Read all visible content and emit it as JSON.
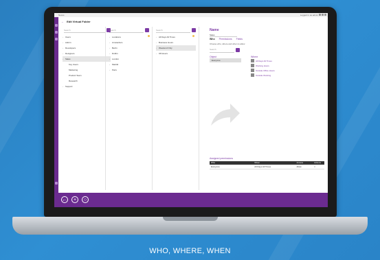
{
  "caption": "WHO, WHERE, WHEN",
  "app": {
    "title": "Edit Virtual Folder",
    "titlebar_left": "Nexus",
    "titlebar_right": "Logged in as admin",
    "search_placeholder": "Search",
    "columns": {
      "col1": [
        {
          "label": "Users",
          "sub": false
        },
        {
          "label": "Admin",
          "sub": false
        },
        {
          "label": "Developers",
          "sub": false
        },
        {
          "label": "Designers",
          "sub": false
        },
        {
          "label": "Sales",
          "sub": false,
          "selected": true
        },
        {
          "label": "Key Users",
          "sub": true
        },
        {
          "label": "Marketing",
          "sub": true
        },
        {
          "label": "Product Team",
          "sub": true
        },
        {
          "label": "Research",
          "sub": true
        },
        {
          "label": "Support",
          "sub": false
        }
      ],
      "col2": [
        {
          "label": "Locations"
        },
        {
          "label": "Amsterdam"
        },
        {
          "label": "Berlin"
        },
        {
          "label": "Dublin"
        },
        {
          "label": "London"
        },
        {
          "label": "Madrid"
        },
        {
          "label": "Paris"
        }
      ],
      "col3": [
        {
          "label": "All Days All Times"
        },
        {
          "label": "Business Hours"
        },
        {
          "label": "Weekend Only",
          "selected": true
        },
        {
          "label": "Off-Hours"
        }
      ]
    },
    "panel": {
      "title": "Name",
      "name_value": "Sales",
      "tabs": [
        "Who",
        "Permissions",
        "Fields"
      ],
      "hint": "Choose who, where and when to allow",
      "search_placeholder": "Search",
      "who_label": "Object",
      "who_item": "Everyone",
      "where_label": "Where",
      "where_items": [
        "All Days All Times",
        "Working Hours",
        "Outside Office Hours",
        "Outside Working"
      ]
    },
    "table": {
      "title": "Assigned permissions",
      "headers": [
        "Who",
        "When",
        "Access",
        "Actions"
      ],
      "rows": [
        [
          "Everyone",
          "All Days All Times",
          "Allow",
          "×"
        ]
      ]
    },
    "bottom_buttons": [
      "←",
      "+",
      "○"
    ]
  }
}
